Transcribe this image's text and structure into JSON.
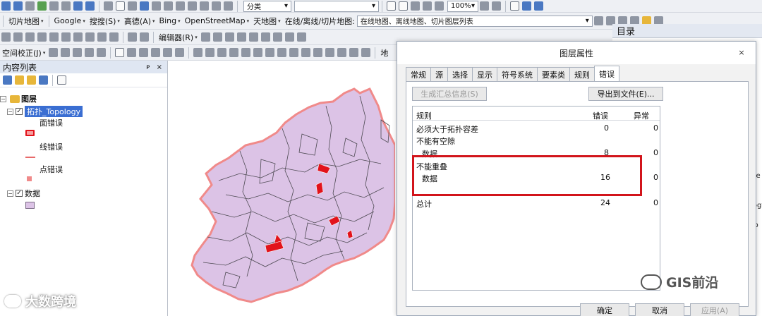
{
  "toolbar_row1": {
    "zoom": "100%",
    "classify": "分类"
  },
  "toolbar_row2": {
    "items": [
      "切片地图",
      "Google",
      "搜搜(S)",
      "高德(A)",
      "Bing",
      "OpenStreetMap",
      "天地图"
    ],
    "combo_label": "在线/离线/切片地图:",
    "combo_value": "在线地图、离线地图、切片图层列表"
  },
  "toolbar_row3": {
    "editor": "编辑器(R)"
  },
  "toolbar_row4": {
    "spatial_adjust": "空间校正(J)",
    "extra": "地"
  },
  "toc": {
    "title": "内容列表",
    "pin": "ᴘ ×",
    "root": "图层",
    "topology_layer": "拓扑_Topology",
    "legend": [
      "面错误",
      "线错误",
      "点错误"
    ],
    "data_layer": "数据"
  },
  "catalog": {
    "title": "目录",
    "frag1": "t.ge",
    "frag2": "ology",
    "frag3": "db"
  },
  "dialog": {
    "title": "图层属性",
    "close": "×",
    "tabs": [
      "常规",
      "源",
      "选择",
      "显示",
      "符号系统",
      "要素类",
      "规则",
      "错误"
    ],
    "generate_summary": "生成汇总信息(S)",
    "export": "导出到文件(E)...",
    "columns": [
      "规则",
      "错误",
      "异常"
    ],
    "rows": [
      {
        "rule": "必须大于拓扑容差",
        "errors": "0",
        "exceptions": "0"
      },
      {
        "rule": "不能有空隙",
        "errors": "",
        "exceptions": ""
      },
      {
        "rule": "数据",
        "errors": "8",
        "exceptions": "0"
      },
      {
        "rule": "不能重叠",
        "errors": "",
        "exceptions": ""
      },
      {
        "rule": "数据",
        "errors": "16",
        "exceptions": "0"
      },
      {
        "rule": "总计",
        "errors": "24",
        "exceptions": "0"
      }
    ],
    "ok": "确定",
    "cancel": "取消",
    "apply": "应用(A)"
  },
  "watermarks": {
    "left": "大数跨境",
    "right": "GIS前沿"
  },
  "colors": {
    "polygon_fill": "#dcc3e6",
    "polygon_outline": "#f08a8a",
    "error_red": "#e2131b",
    "highlight_box": "#d2141b"
  }
}
